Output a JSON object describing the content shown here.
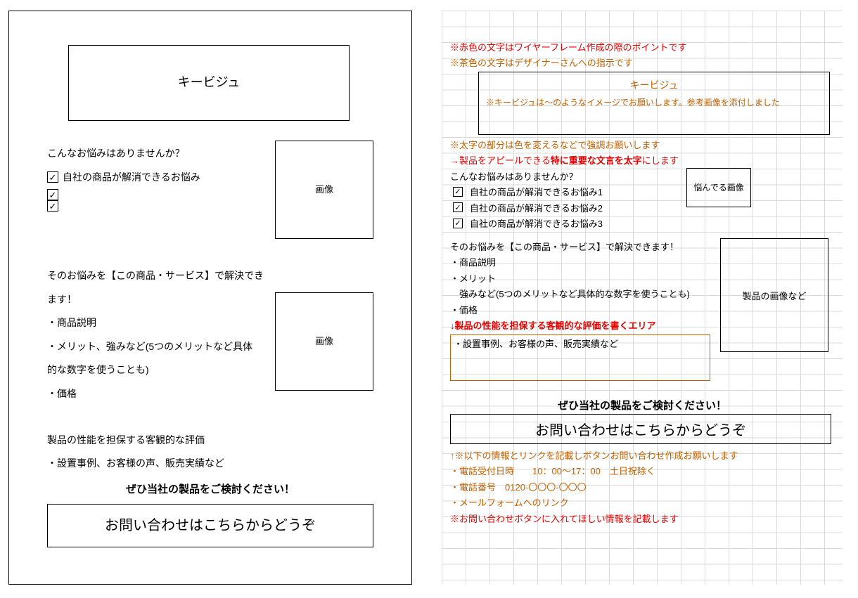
{
  "left": {
    "kv": "キービジュ",
    "worry_q": "こんなお悩みはありませんか？",
    "worry_item": "自社の商品が解消できるお悩み",
    "img_label": "画像",
    "solve_title": "そのお悩みを【この商品・サービス】で解決できます！",
    "solve_l1": "・商品説明",
    "solve_l2": "・メリット、強みなど(5つのメリットなど具体",
    "solve_l3": "的な数字を使うことも)",
    "solve_l4": "・価格",
    "perf_title": "製品の性能を担保する客観的な評価",
    "perf_l1": "・設置事例、お客様の声、販売実績など",
    "cta_title": "ぜひ当社の製品をご検討ください！",
    "cta_box": "お問い合わせはこちらからどうぞ"
  },
  "right": {
    "note_red1": "※赤色の文字はワイヤーフレーム作成の際のポイントです",
    "note_brown1": "※茶色の文字はデザイナーさんへの指示です",
    "kv_title": "キービジュ",
    "kv_sub": "※キービジュは～のようなイメージでお願いします。参考画像を添付しました",
    "emph_brown": "※太字の部分は色を変えるなどで強調お願いします",
    "emph_red_a": "→製品をアピールできる",
    "emph_red_b": "特に重要な文言を太字",
    "emph_red_c": "にします",
    "worry_q": "こんなお悩みはありませんか？",
    "worry1": "自社の商品が解消できるお悩み1",
    "worry2": "自社の商品が解消できるお悩み2",
    "worry3": "自社の商品が解消できるお悩み3",
    "worry_img": "悩んでる画像",
    "solve_title": "そのお悩みを【この商品・サービス】で解決できます！",
    "solve_l1": "・商品説明",
    "solve_l2": "・メリット",
    "solve_l3": "　強みなど(5つのメリットなど具体的な数字を使うことも)",
    "solve_l4": "・価格",
    "solve_img": "製品の画像など",
    "perf_title": "↓製品の性能を担保する客観的な評価を書くエリア",
    "perf_l1": "・設置事例、お客様の声、販売実績など",
    "cta_title": "ぜひ当社の製品をご検討ください！",
    "cta_box": "お問い合わせはこちらからどうぞ",
    "foot_brown1": "↑※以下の情報とリンクを記載しボタンお問い合わせ作成お願いします",
    "foot_brown2": "・電話受付日時　　10：00～17：00　土日祝除く",
    "foot_brown3": "・電話番号　0120-〇〇〇-〇〇〇",
    "foot_brown4": "・メールフォームへのリンク",
    "foot_red": "※お問い合わせボタンに入れてほしい情報を記載します"
  }
}
